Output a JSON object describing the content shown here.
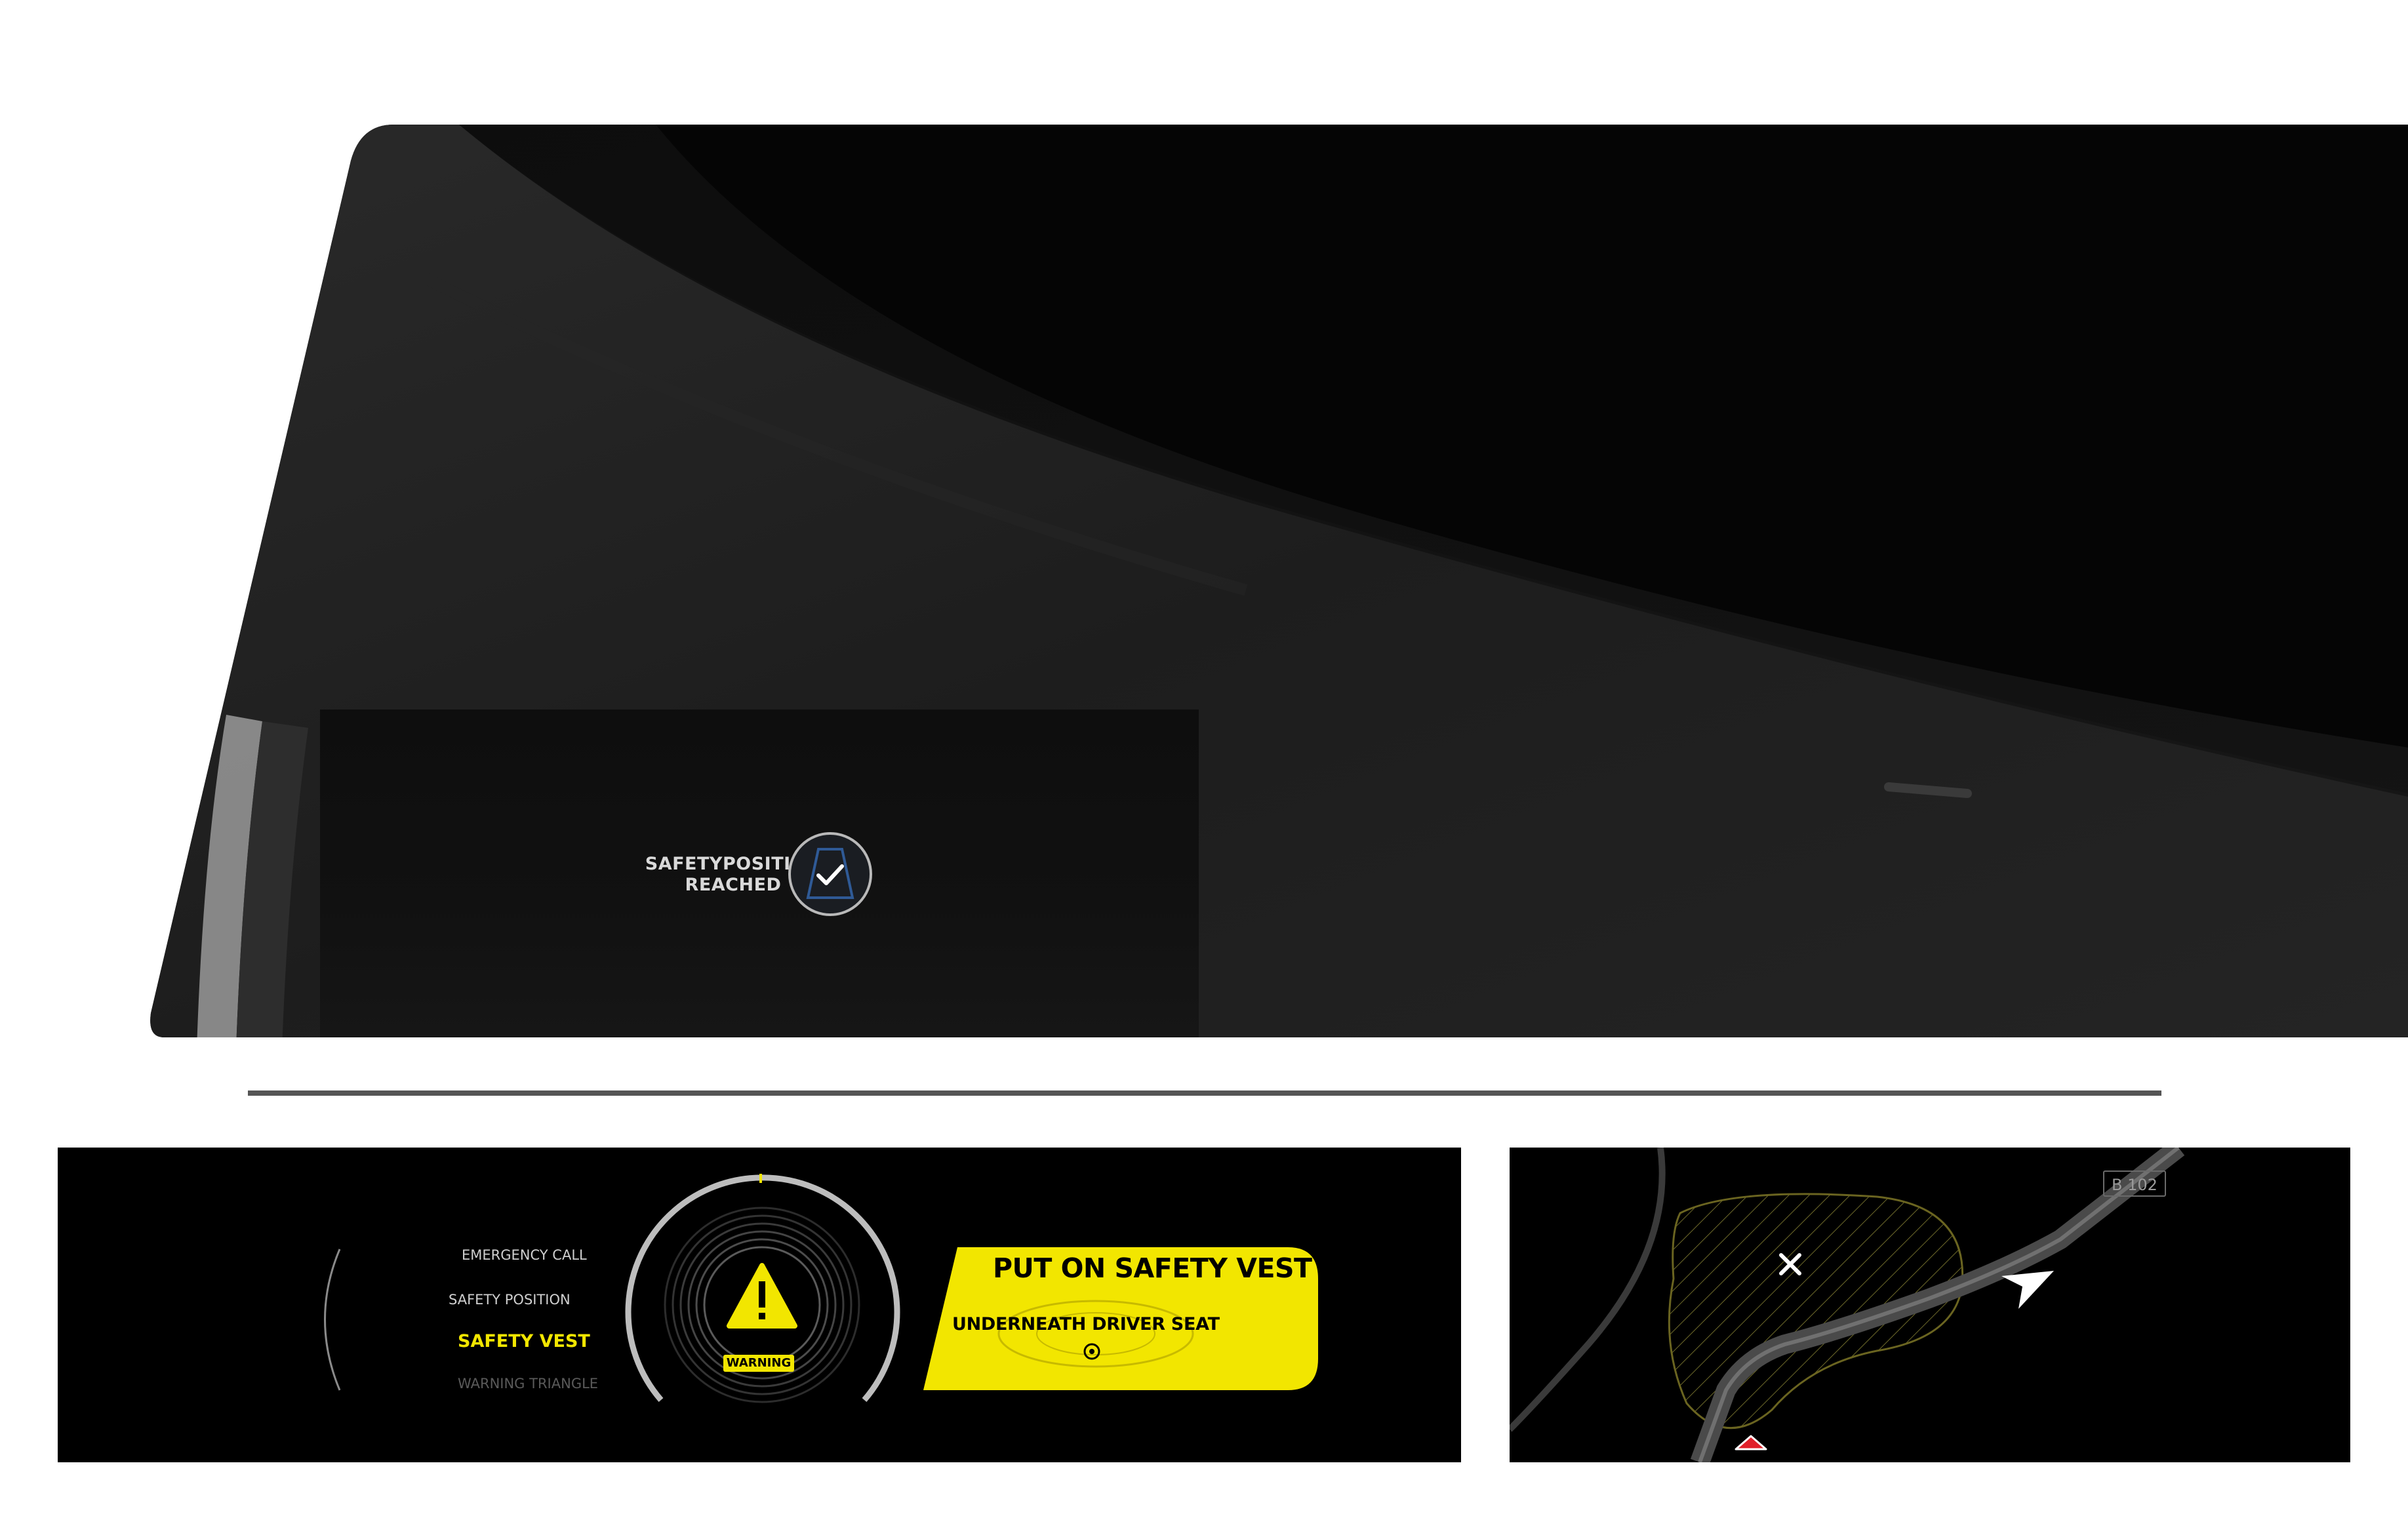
{
  "hud": {
    "status_line1": "SAFETYPOSITION",
    "status_line2": "REACHED",
    "status_icon": "check-circle-icon",
    "accent_color": "#2f4f7f"
  },
  "cluster": {
    "menu": [
      {
        "label": "EMERGENCY CALL",
        "state": "inactive"
      },
      {
        "label": "SAFETY POSITION",
        "state": "inactive"
      },
      {
        "label": "SAFETY VEST",
        "state": "active"
      },
      {
        "label": "WARNING TRIANGLE",
        "state": "disabled"
      }
    ],
    "warning_label": "WARNING",
    "alert_title": "PUT ON SAFETY VEST",
    "alert_subtitle": "UNDERNEATH DRIVER SEAT",
    "accent_color": "#f2e600"
  },
  "map": {
    "road_sign": "B 102",
    "hazard_color": "#e0202a"
  }
}
